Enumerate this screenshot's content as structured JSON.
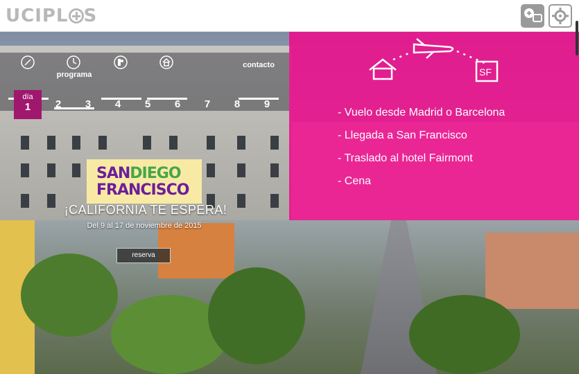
{
  "header": {
    "logo_text": "UCIPL",
    "logo_tail": "S",
    "buttons": [
      {
        "icon": "add-chat-icon"
      },
      {
        "icon": "settings-gear-icon"
      }
    ]
  },
  "nav": {
    "items": [
      {
        "icon": "pen-icon",
        "label": ""
      },
      {
        "icon": "clock-icon",
        "label": "programa"
      },
      {
        "icon": "registered-icon",
        "label": ""
      },
      {
        "icon": "building-icon",
        "label": ""
      },
      {
        "icon": "",
        "label": "contacto"
      }
    ]
  },
  "days": {
    "active_label": "día",
    "items": [
      "1",
      "2",
      "3",
      "4",
      "5",
      "6",
      "7",
      "8",
      "9"
    ]
  },
  "itinerary": {
    "icons": [
      "home-icon",
      "plane-icon",
      "sf-icon"
    ],
    "sf_label": "SF",
    "items": [
      "- Vuelo desde Madrid o Barcelona",
      "- Llegada a San Francisco",
      "- Traslado al hotel Fairmont",
      "- Cena"
    ]
  },
  "promo": {
    "line1_a": "SAN",
    "line1_b": "DIEGO",
    "line2": "FRANCISCO",
    "tagline": "¡CALIFORNIA TE ESPERA!",
    "dates": "Del 9 al 17 de noviembre de 2015",
    "cta": "reserva"
  },
  "colors": {
    "accent_pink": "#e8148c",
    "active_day": "#a0176e"
  }
}
